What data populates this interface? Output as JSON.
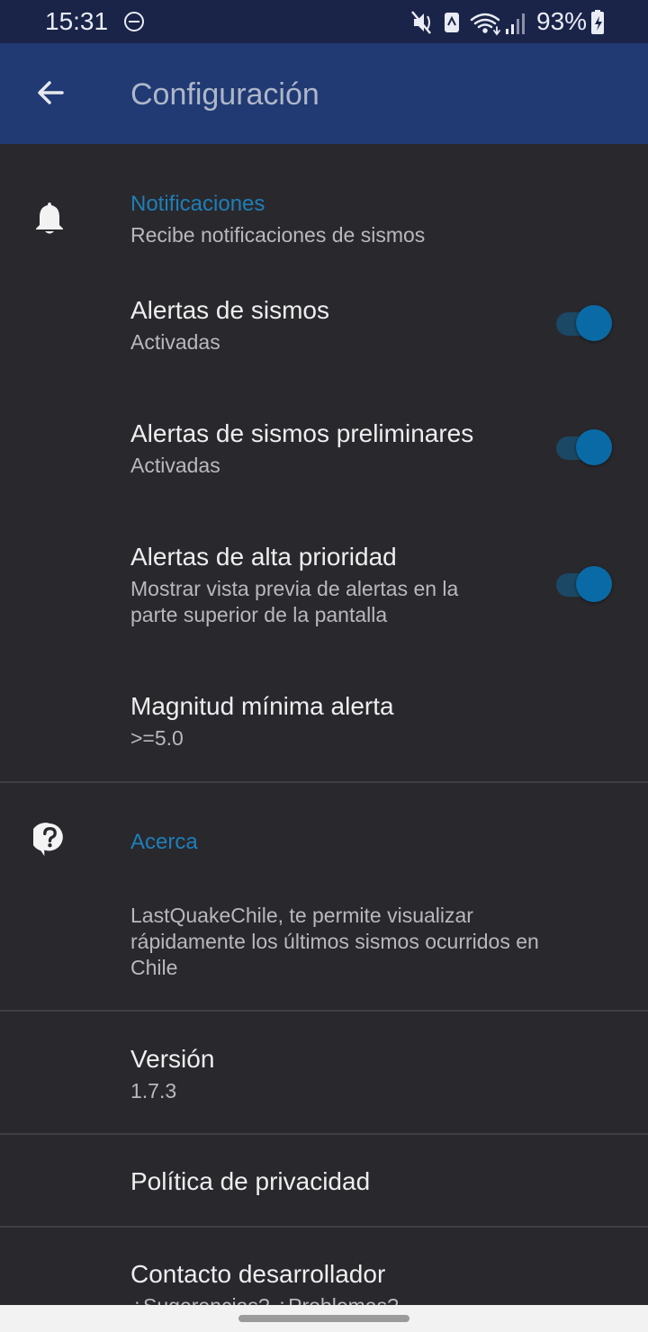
{
  "status_bar": {
    "time": "15:31",
    "battery": "93%",
    "icons": [
      "dnd-icon",
      "mute-icon",
      "nfc-icon",
      "wifi-icon",
      "signal-icon",
      "battery-charging-icon"
    ]
  },
  "app_bar": {
    "title": "Configuración",
    "back_icon": "arrow-back-icon"
  },
  "notifications": {
    "category": "Notificaciones",
    "summary": "Recibe notificaciones de sismos",
    "icon": "bell-icon",
    "items": [
      {
        "title": "Alertas de sismos",
        "summary": "Activadas",
        "toggle": true
      },
      {
        "title": "Alertas de sismos preliminares",
        "summary": "Activadas",
        "toggle": true
      },
      {
        "title": "Alertas de alta prioridad",
        "summary_line1": "Mostrar vista previa de alertas en la",
        "summary_line2": "parte superior de la pantalla",
        "toggle": true
      },
      {
        "title": "Magnitud mínima alerta",
        "summary": ">=5.0"
      }
    ]
  },
  "about": {
    "category": "Acerca",
    "icon": "help-icon",
    "description_line1": "LastQuakeChile, te permite visualizar",
    "description_line2": "rápidamente los últimos sismos ocurridos en",
    "description_line3": "Chile",
    "version_title": "Versión",
    "version_value": "1.7.3",
    "privacy_title": "Política de privacidad",
    "contact_title": "Contacto desarrollador",
    "contact_summary": "¿Sugerencias? ¿Problemas?"
  },
  "colors": {
    "background": "#29282d",
    "app_bar": "#213a73",
    "status_bar": "#1a2448",
    "accent": "#1e7fb8",
    "toggle_thumb": "#0a6aa5"
  }
}
